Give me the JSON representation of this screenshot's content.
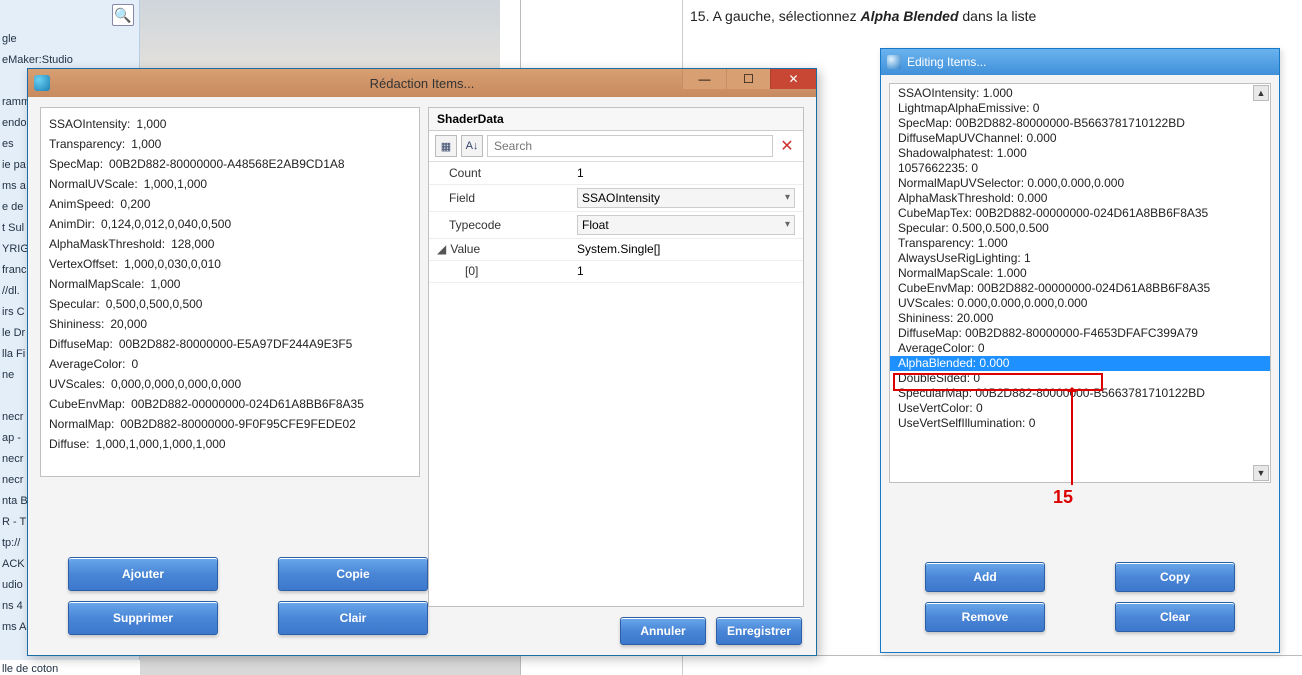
{
  "instruction": {
    "number": "15.",
    "pre": "A gauche, sélectionnez ",
    "target": "Alpha Blended",
    "post": " dans la liste"
  },
  "sidebar": {
    "items": [
      "gle",
      "eMaker:Studio",
      "",
      "ramm",
      "endo",
      "es",
      "ie pa",
      "ms a",
      "e de",
      "t Sul",
      "YRIG",
      "franc",
      "//dl.",
      "irs C",
      "le Dr",
      "lla Fi",
      "ne",
      "",
      "necr",
      "ap -",
      "necr",
      "necr",
      "nta B",
      "R - T",
      "tp://",
      "ACK",
      "udio",
      "ns 4",
      "ms A"
    ],
    "bottom": "lle de coton"
  },
  "dialog_fr": {
    "title": "Rédaction Items...",
    "shader_panel_title": "ShaderData",
    "search_placeholder": "Search",
    "properties": [
      {
        "k": "SSAOIntensity",
        "v": "1,000"
      },
      {
        "k": "Transparency",
        "v": "1,000"
      },
      {
        "k": "SpecMap",
        "v": "00B2D882-80000000-A48568E2AB9CD1A8"
      },
      {
        "k": "NormalUVScale",
        "v": "1,000,1,000"
      },
      {
        "k": "AnimSpeed",
        "v": "0,200"
      },
      {
        "k": "AnimDir",
        "v": "0,124,0,012,0,040,0,500"
      },
      {
        "k": "AlphaMaskThreshold",
        "v": "128,000"
      },
      {
        "k": "VertexOffset",
        "v": "1,000,0,030,0,010"
      },
      {
        "k": "NormalMapScale",
        "v": "1,000"
      },
      {
        "k": "Specular",
        "v": "0,500,0,500,0,500"
      },
      {
        "k": "Shininess",
        "v": "20,000"
      },
      {
        "k": "DiffuseMap",
        "v": "00B2D882-80000000-E5A97DF244A9E3F5"
      },
      {
        "k": "AverageColor",
        "v": "0"
      },
      {
        "k": "UVScales",
        "v": "0,000,0,000,0,000,0,000"
      },
      {
        "k": "CubeEnvMap",
        "v": "00B2D882-00000000-024D61A8BB6F8A35"
      },
      {
        "k": "NormalMap",
        "v": "00B2D882-80000000-9F0F95CFE9FEDE02"
      },
      {
        "k": "Diffuse",
        "v": "1,000,1,000,1,000,1,000"
      }
    ],
    "right_table": {
      "count_label": "Count",
      "count_value": "1",
      "field_label": "Field",
      "field_value": "SSAOIntensity",
      "typecode_label": "Typecode",
      "typecode_value": "Float",
      "value_label": "Value",
      "value_value": "System.Single[]",
      "index_label": "[0]",
      "index_value": "1"
    },
    "buttons": {
      "add": "Ajouter",
      "copy": "Copie",
      "remove": "Supprimer",
      "clear": "Clair",
      "cancel": "Annuler",
      "save": "Enregistrer"
    }
  },
  "dialog_en": {
    "title": "Editing Items...",
    "list": [
      {
        "k": "SSAOIntensity",
        "v": "1.000"
      },
      {
        "k": "LightmapAlphaEmissive",
        "v": "0"
      },
      {
        "k": "SpecMap",
        "v": "00B2D882-80000000-B5663781710122BD"
      },
      {
        "k": "DiffuseMapUVChannel",
        "v": "0.000"
      },
      {
        "k": "Shadowalphatest",
        "v": "1.000"
      },
      {
        "k": "1057662235",
        "v": "0"
      },
      {
        "k": "NormalMapUVSelector",
        "v": "0.000,0.000,0.000"
      },
      {
        "k": "AlphaMaskThreshold",
        "v": "0.000"
      },
      {
        "k": "CubeMapTex",
        "v": "00B2D882-00000000-024D61A8BB6F8A35"
      },
      {
        "k": "Specular",
        "v": "0.500,0.500,0.500"
      },
      {
        "k": "Transparency",
        "v": "1.000"
      },
      {
        "k": "AlwaysUseRigLighting",
        "v": "1"
      },
      {
        "k": "NormalMapScale",
        "v": "1.000"
      },
      {
        "k": "CubeEnvMap",
        "v": "00B2D882-00000000-024D61A8BB6F8A35"
      },
      {
        "k": "UVScales",
        "v": "0.000,0.000,0.000,0.000"
      },
      {
        "k": "Shininess",
        "v": "20.000"
      },
      {
        "k": "DiffuseMap",
        "v": "00B2D882-80000000-F4653DFAFC399A79"
      },
      {
        "k": "AverageColor",
        "v": "0"
      },
      {
        "k": "AlphaBlended",
        "v": "0.000",
        "sel": true
      },
      {
        "k": "DoubleSided",
        "v": "0"
      },
      {
        "k": "SpecularMap",
        "v": "00B2D882-80000000-B5663781710122BD"
      },
      {
        "k": "UseVertColor",
        "v": "0"
      },
      {
        "k": "UseVertSelfIllumination",
        "v": "0"
      }
    ],
    "buttons": {
      "add": "Add",
      "copy": "Copy",
      "remove": "Remove",
      "clear": "Clear"
    },
    "callout": "15"
  }
}
